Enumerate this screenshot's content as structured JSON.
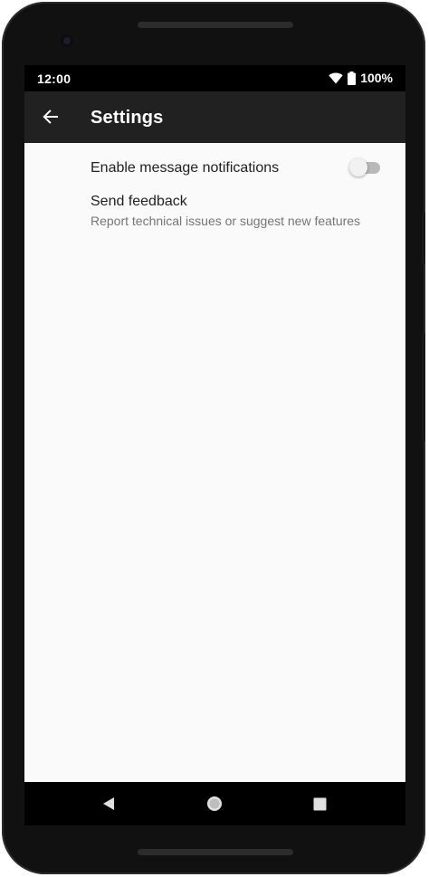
{
  "status_bar": {
    "time": "12:00",
    "battery_text": "100%",
    "icons": [
      "wifi-icon",
      "battery-icon"
    ]
  },
  "app_bar": {
    "title": "Settings",
    "back_icon": "arrow-back-icon"
  },
  "preferences": [
    {
      "title": "Enable message notifications",
      "type": "switch",
      "checked": false
    },
    {
      "title": "Send feedback",
      "summary": "Report technical issues or suggest new features"
    }
  ],
  "navigation_bar": {
    "buttons": [
      "back-triangle-icon",
      "home-circle-icon",
      "recents-square-icon"
    ]
  },
  "colors": {
    "app_bar": "#212121",
    "screen_background": "#fafafa",
    "status_bar": "#000000",
    "primary_text": "#212121",
    "secondary_text": "#757575",
    "switch_track_off": "#b9b9b9",
    "switch_thumb_off": "#f1f1f1"
  }
}
